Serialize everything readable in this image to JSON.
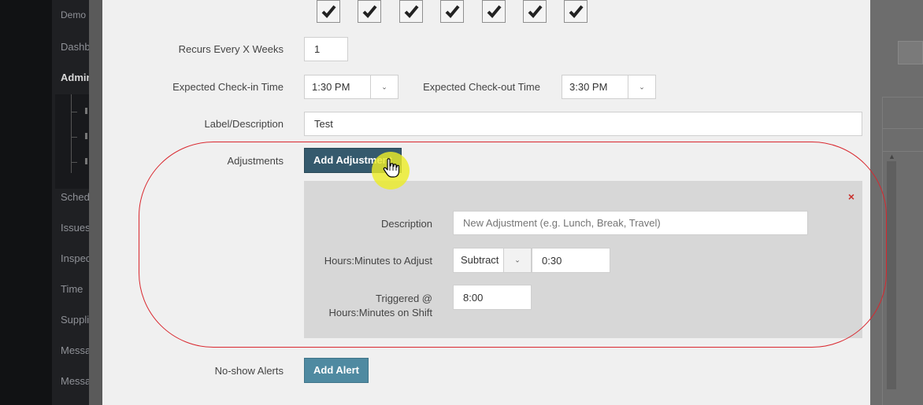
{
  "sidebar": {
    "items": [
      {
        "label": "Demo",
        "bold": false
      },
      {
        "label": "Dashboard",
        "bold": false
      },
      {
        "label": "Administration",
        "bold": true
      },
      {
        "label": "Schedule",
        "bold": false
      },
      {
        "label": "Issues",
        "bold": false
      },
      {
        "label": "Inspections",
        "bold": false
      },
      {
        "label": "Time",
        "bold": false
      },
      {
        "label": "Supplies",
        "bold": false
      },
      {
        "label": "Messages",
        "bold": false
      },
      {
        "label": "Messages",
        "bold": false
      }
    ]
  },
  "form": {
    "weekdays_checked": [
      true,
      true,
      true,
      true,
      true,
      true,
      true
    ],
    "recurs_label": "Recurs Every X Weeks",
    "recurs_value": "1",
    "checkin_label": "Expected Check-in Time",
    "checkin_value": "1:30 PM",
    "checkout_label": "Expected Check-out Time",
    "checkout_value": "3:30 PM",
    "label_desc_label": "Label/Description",
    "label_desc_value": "Test",
    "adjustments_label": "Adjustments",
    "add_adjustment_button": "Add Adjustment",
    "noshow_label": "No-show Alerts",
    "add_alert_button": "Add Alert"
  },
  "adjustment": {
    "close_symbol": "×",
    "description_label": "Description",
    "description_placeholder": "New Adjustment (e.g. Lunch, Break, Travel)",
    "hours_label": "Hours:Minutes to Adjust",
    "operation_value": "Subtract",
    "hours_value": "0:30",
    "triggered_label_line1": "Triggered @",
    "triggered_label_line2": "Hours:Minutes on Shift",
    "triggered_value": "8:00"
  },
  "colors": {
    "primary_button": "#355a6d",
    "secondary_button": "#4f8aa1",
    "highlight": "#d9272e",
    "close": "#c9302c"
  }
}
